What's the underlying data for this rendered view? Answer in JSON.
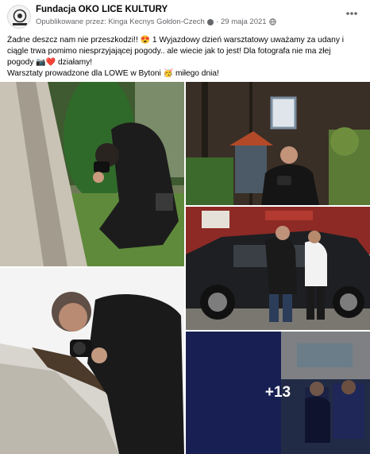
{
  "post": {
    "page_name": "Fundacja OKO   LICE KULTURY",
    "published_by": "Opublikowane przez: Kinga Kecnys Gołdon-Czech",
    "date": "29 maja 2021",
    "more_icon": "ellipsis-icon",
    "text_line1": "Żadne deszcz nam nie przeszkodzi!! ",
    "text_line1_after": " 1 Wyjazdowy dzień warsztatowy uważamy za udany i",
    "text_line2": "ciągle trwa pomimo niesprzyjającej pogody.. ale wiecie jak to jest! Dla fotografa nie ma złej",
    "text_line3": "pogody ",
    "text_line3_after": " działamy!",
    "text_line4": "Warsztaty prowadzone dla LOWE w Bytoni ",
    "text_line4_after": " miłego dnia!",
    "emoji_heart_eyes": "😍",
    "emoji_camera_heart": "📷❤️",
    "emoji_party": "🥳"
  },
  "gallery": {
    "more_count": "+13",
    "photos": [
      {
        "name": "photographer-crouching-by-tree"
      },
      {
        "name": "photographer-by-wooden-house"
      },
      {
        "name": "photographers-by-black-car"
      },
      {
        "name": "photographer-at-birch-trunk"
      },
      {
        "name": "bus-interior-with-passengers"
      }
    ]
  },
  "colors": {
    "text_primary": "#050505",
    "text_secondary": "#65676b",
    "overlay": "rgba(0,0,0,0.42)"
  }
}
